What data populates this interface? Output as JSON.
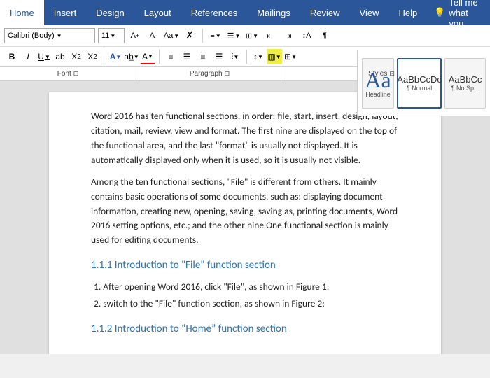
{
  "menubar": {
    "tabs": [
      "Home",
      "Insert",
      "Design",
      "Layout",
      "References",
      "Mailings",
      "Review",
      "View",
      "Help"
    ],
    "active_tab": "Home",
    "tell_me": "Tell me what you",
    "lightbulb": "💡"
  },
  "ribbon": {
    "font_name": "Calibri (Body)",
    "font_size": "11",
    "paragraph_label": "Paragraph",
    "font_label": "Font",
    "styles_label": "Styles"
  },
  "styles_panel": {
    "headline_big": "Aa",
    "headline_label": "Headline",
    "normal_text": "AaBbCcDc",
    "normal_label": "¶ Normal",
    "no_spacing_text": "AaBbCc",
    "no_spacing_label": "¶ No Sp..."
  },
  "document": {
    "paragraphs": [
      "Word 2016 has ten functional sections, in order: file, start, insert, design, layout, citation, mail, review, view and format. The first nine are displayed on the top of the functional area, and the last \"format\" is usually not displayed. It is automatically displayed only when it is used, so it is usually not visible.",
      "Among the ten functional sections, \"File\" is different from others. It mainly contains basic operations of some documents, such as: displaying document information, creating new, opening, saving, saving as, printing documents, Word 2016 setting options, etc.; and the other nine One functional section is mainly used for editing documents."
    ],
    "section1": {
      "heading": "1.1.1 Introduction to \"File\" function section",
      "items": [
        "1. After opening Word 2016, click \"File\", as shown in Figure 1:",
        "2. switch to the \"File\" function section, as shown in Figure 2:"
      ]
    },
    "section2": {
      "heading": "1.1.2 Introduction to “Home” function section"
    }
  }
}
